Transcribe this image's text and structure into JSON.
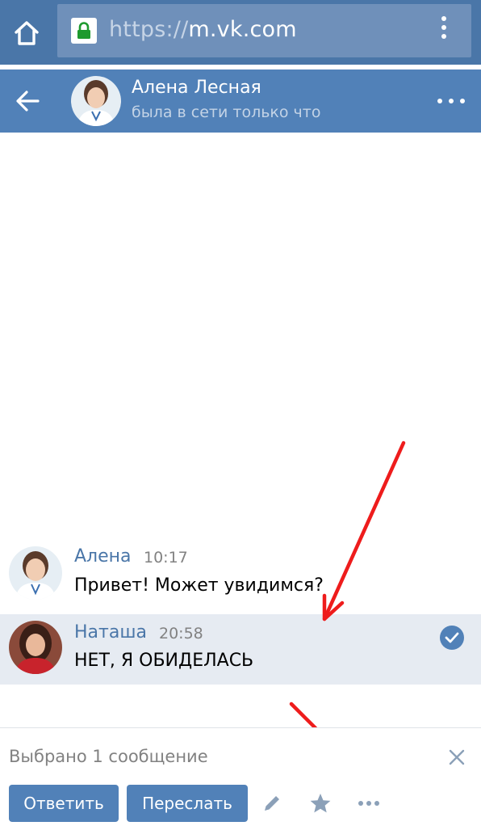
{
  "browser": {
    "url_scheme": "https://",
    "url_host": "m.vk.com",
    "home_icon": "home-icon",
    "lock_icon": "lock-icon",
    "menu_icon": "vertical-dots-icon"
  },
  "chat_header": {
    "contact_name": "Алена Лесная",
    "contact_status": "была в сети только что",
    "back_icon": "arrow-left-icon",
    "more_icon": "horizontal-dots-icon"
  },
  "messages": [
    {
      "author": "Алена",
      "time": "10:17",
      "text": "Привет! Может увидимся?",
      "selected": false
    },
    {
      "author": "Наташа",
      "time": "20:58",
      "text": "НЕТ, Я ОБИДЕЛАСЬ",
      "selected": true
    }
  ],
  "action_panel": {
    "selected_label": "Выбрано 1 сообщение",
    "reply_label": "Ответить",
    "forward_label": "Переслать",
    "tools": [
      "pencil-icon",
      "star-icon",
      "horizontal-dots-icon"
    ]
  },
  "colors": {
    "browser_bar": "#4a76a8",
    "vk_header": "#5181b8",
    "selected_row": "#e6ebf2",
    "button": "#5181b8",
    "annotation_arrow": "#ee1c1c"
  }
}
